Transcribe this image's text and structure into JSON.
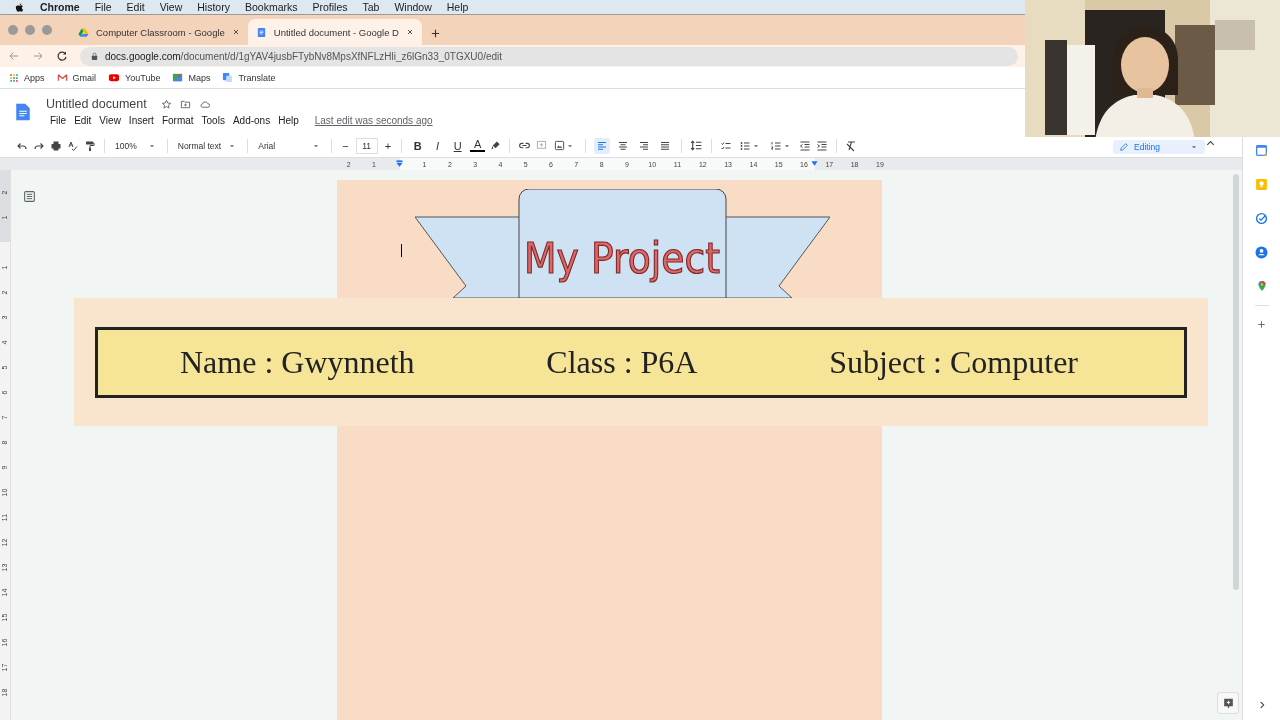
{
  "mac_menu": {
    "app": "Chrome",
    "items": [
      "File",
      "Edit",
      "View",
      "History",
      "Bookmarks",
      "Profiles",
      "Tab",
      "Window",
      "Help"
    ]
  },
  "tabs": [
    {
      "title": "Computer Classroom - Google",
      "selected": false
    },
    {
      "title": "Untitled document - Google D",
      "selected": true
    }
  ],
  "address": {
    "host": "docs.google.com",
    "path": "/document/d/1gYAV4jusbFTybNv8MpsXfNFLzHli_z6lGn33_0TGXU0/edit"
  },
  "bookmarks": [
    "Apps",
    "Gmail",
    "YouTube",
    "Maps",
    "Translate"
  ],
  "document": {
    "title": "Untitled document",
    "menu": [
      "File",
      "Edit",
      "View",
      "Insert",
      "Format",
      "Tools",
      "Add-ons",
      "Help"
    ],
    "last_edit": "Last edit was seconds ago"
  },
  "toolbar": {
    "zoom": "100%",
    "style": "Normal text",
    "font": "Arial",
    "size_minus": "−",
    "font_size": "11",
    "size_plus": "+",
    "format": [
      "B",
      "I",
      "U",
      "A"
    ],
    "align": [
      {
        "selected": true
      },
      {
        "selected": false
      },
      {
        "selected": false
      },
      {
        "selected": false
      }
    ],
    "mode": "Editing"
  },
  "ruler": {
    "before": [
      "2",
      "1"
    ],
    "after": [
      "1",
      "2",
      "3",
      "4",
      "5",
      "6",
      "7",
      "8",
      "9",
      "10",
      "11",
      "12",
      "13",
      "14",
      "15",
      "16",
      "17",
      "18",
      "19"
    ]
  },
  "side_ruler": {
    "before": [
      "2",
      "1"
    ],
    "after": [
      "1",
      "2",
      "3",
      "4",
      "5",
      "6",
      "7",
      "8",
      "9",
      "10",
      "11",
      "12",
      "13",
      "14",
      "15",
      "16",
      "17",
      "18"
    ]
  },
  "page": {
    "banner_title": "My Project",
    "info": [
      "Name : Gwynneth",
      "Class : P6A",
      "Subject : Computer"
    ]
  }
}
